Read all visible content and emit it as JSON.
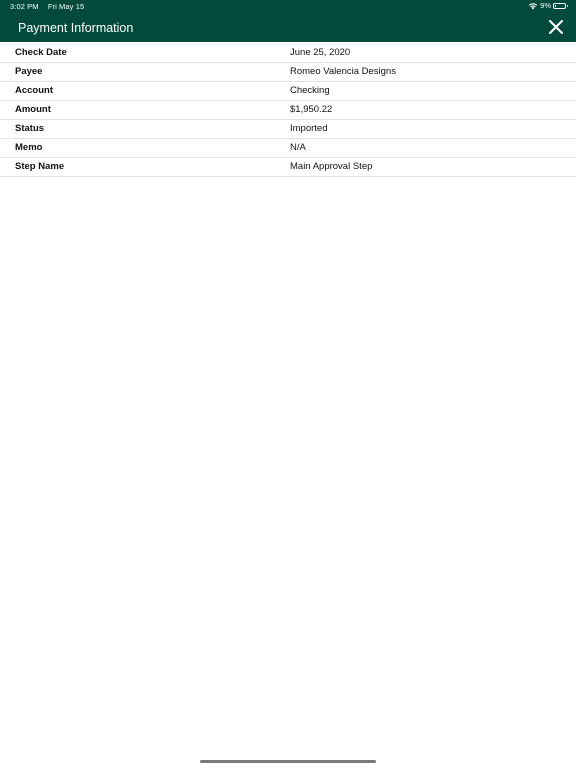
{
  "status_bar": {
    "time": "3:02 PM",
    "date": "Fri May 15",
    "battery_percent_label": "9%",
    "battery_level": 0.09
  },
  "header": {
    "title": "Payment Information",
    "background_color": "#024b3a",
    "close_icon": "close-icon"
  },
  "details": [
    {
      "label": "Check Date",
      "value": "June 25, 2020"
    },
    {
      "label": "Payee",
      "value": "Romeo Valencia Designs"
    },
    {
      "label": "Account",
      "value": "Checking"
    },
    {
      "label": "Amount",
      "value": "$1,950.22"
    },
    {
      "label": "Status",
      "value": "Imported"
    },
    {
      "label": "Memo",
      "value": "N/A"
    },
    {
      "label": "Step Name",
      "value": "Main Approval Step"
    }
  ]
}
